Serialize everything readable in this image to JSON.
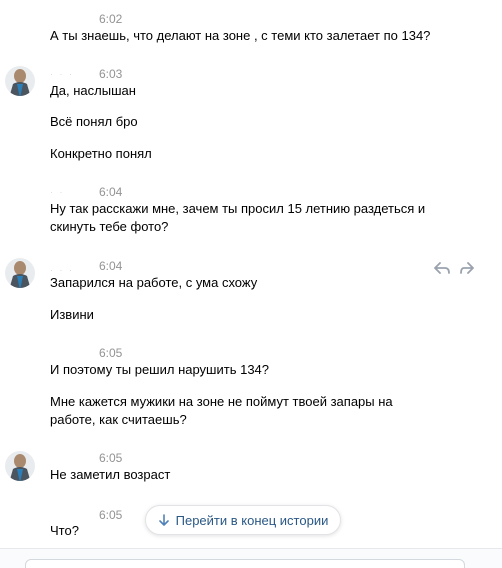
{
  "messages": [
    {
      "time": "6:02",
      "lines": [
        "А ты знаешь, что делают на зоне , с теми кто залетает по 134?"
      ]
    },
    {
      "time": "6:03",
      "lines": [
        "Да, наслышан",
        "Всё понял бро",
        "Конкретно понял"
      ]
    },
    {
      "time": "6:04",
      "lines": [
        "Ну так расскажи мне, зачем ты просил 15 летнию раздеться и",
        "скинуть тебе фото?"
      ]
    },
    {
      "time": "6:04",
      "lines": [
        "Запарился на работе, с ума схожу",
        "Извини"
      ]
    },
    {
      "time": "6:05",
      "lines": [
        "И поэтому ты решил нарушить 134?",
        "Мне кажется мужики на зоне не поймут твоей запары на",
        "работе, как считаешь?"
      ]
    },
    {
      "time": "6:05",
      "lines": [
        "Не заметил возраст"
      ]
    },
    {
      "time": "6:05",
      "lines": [
        "Что?"
      ]
    }
  ],
  "jump_button": {
    "label": "Перейти в конец истории"
  },
  "colors": {
    "time": "#939393",
    "link": "#2a5885",
    "text": "#000000"
  }
}
